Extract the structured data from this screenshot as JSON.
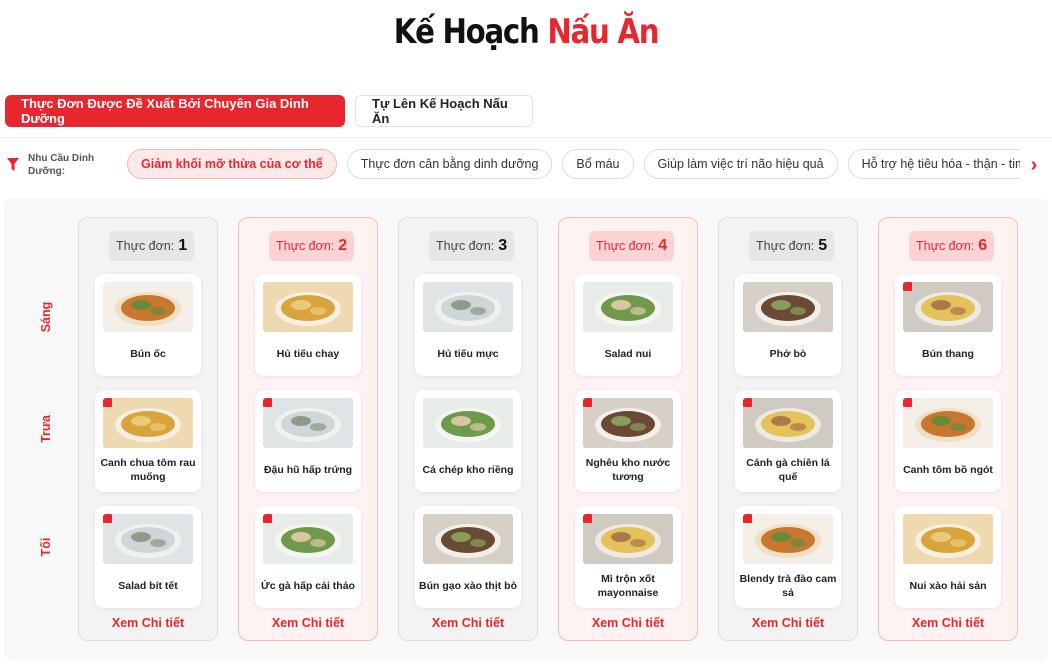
{
  "header": {
    "title_main": "Kế Hoạch",
    "title_accent": "Nấu Ăn"
  },
  "tabs": [
    {
      "label": "Thực Đơn Được Đề Xuất Bởi Chuyên Gia Dinh Dưỡng",
      "active": true
    },
    {
      "label": "Tự Lên Kế Hoạch Nấu Ăn",
      "active": false
    }
  ],
  "filter": {
    "label": "Nhu Cầu Dinh Dưỡng:",
    "chips": [
      {
        "label": "Giảm khối mỡ thừa của cơ thể",
        "active": true
      },
      {
        "label": "Thực đơn cân bằng dinh dưỡng",
        "active": false
      },
      {
        "label": "Bổ máu",
        "active": false
      },
      {
        "label": "Giúp làm việc trí não hiệu quả",
        "active": false
      },
      {
        "label": "Hỗ trợ hệ tiêu hóa - thận - tim mạch",
        "active": false
      }
    ],
    "next_icon": "chevron-right-icon"
  },
  "meals": {
    "breakfast": "Sáng",
    "lunch": "Trưa",
    "dinner": "Tối"
  },
  "menu_prefix": "Thực đơn:",
  "detail_label": "Xem Chi tiết",
  "colors": {
    "accent": "#e8262d",
    "pink_bg": "#fff2f2",
    "grey_bg": "#f3f3f3"
  },
  "menus": [
    {
      "number": "1",
      "style": "grey",
      "dishes": [
        {
          "name": "Bún ốc"
        },
        {
          "name": "Canh chua tôm rau muống"
        },
        {
          "name": "Salad bít tết"
        }
      ]
    },
    {
      "number": "2",
      "style": "pink",
      "dishes": [
        {
          "name": "Hủ tiếu chay"
        },
        {
          "name": "Đậu hũ hấp trứng"
        },
        {
          "name": "Ức gà hấp cải thảo"
        }
      ]
    },
    {
      "number": "3",
      "style": "grey",
      "dishes": [
        {
          "name": "Hủ tiếu mực"
        },
        {
          "name": "Cá chép kho riềng"
        },
        {
          "name": "Bún gạo xào thịt bò"
        }
      ]
    },
    {
      "number": "4",
      "style": "pink",
      "dishes": [
        {
          "name": "Salad nui"
        },
        {
          "name": "Nghêu kho nước tương"
        },
        {
          "name": "Mì trộn xốt mayonnaise"
        }
      ]
    },
    {
      "number": "5",
      "style": "grey",
      "dishes": [
        {
          "name": "Phở bò"
        },
        {
          "name": "Cánh gà chiên lá quế"
        },
        {
          "name": "Blendy trà đào cam sả"
        }
      ]
    },
    {
      "number": "6",
      "style": "pink",
      "dishes": [
        {
          "name": "Bún thang"
        },
        {
          "name": "Canh tôm bồ ngót"
        },
        {
          "name": "Nui xào hải sản"
        }
      ]
    }
  ]
}
